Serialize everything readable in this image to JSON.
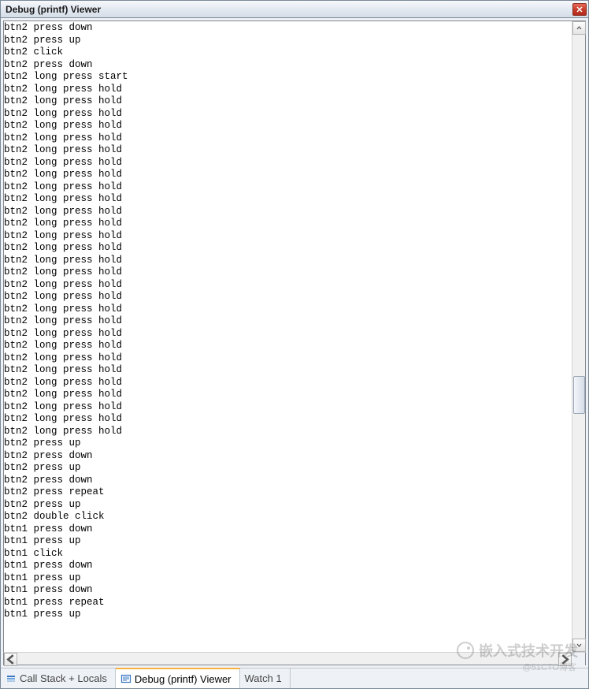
{
  "window": {
    "title": "Debug (printf) Viewer"
  },
  "output_lines": [
    "btn2 press down",
    "btn2 press up",
    "btn2 click",
    "btn2 press down",
    "btn2 long press start",
    "btn2 long press hold",
    "btn2 long press hold",
    "btn2 long press hold",
    "btn2 long press hold",
    "btn2 long press hold",
    "btn2 long press hold",
    "btn2 long press hold",
    "btn2 long press hold",
    "btn2 long press hold",
    "btn2 long press hold",
    "btn2 long press hold",
    "btn2 long press hold",
    "btn2 long press hold",
    "btn2 long press hold",
    "btn2 long press hold",
    "btn2 long press hold",
    "btn2 long press hold",
    "btn2 long press hold",
    "btn2 long press hold",
    "btn2 long press hold",
    "btn2 long press hold",
    "btn2 long press hold",
    "btn2 long press hold",
    "btn2 long press hold",
    "btn2 long press hold",
    "btn2 long press hold",
    "btn2 long press hold",
    "btn2 long press hold",
    "btn2 long press hold",
    "btn2 press up",
    "btn2 press down",
    "btn2 press up",
    "btn2 press down",
    "btn2 press repeat",
    "btn2 press up",
    "btn2 double click",
    "btn1 press down",
    "btn1 press up",
    "btn1 click",
    "btn1 press down",
    "btn1 press up",
    "btn1 press down",
    "btn1 press repeat",
    "btn1 press up"
  ],
  "tabs": [
    {
      "label": "Call Stack + Locals",
      "icon": "stack-icon",
      "active": false
    },
    {
      "label": "Debug (printf) Viewer",
      "icon": "printf-icon",
      "active": true
    },
    {
      "label": "Watch 1",
      "icon": "",
      "active": false
    }
  ],
  "watermark": {
    "main": "嵌入式技术开发",
    "sub": "@51CTO博客"
  }
}
